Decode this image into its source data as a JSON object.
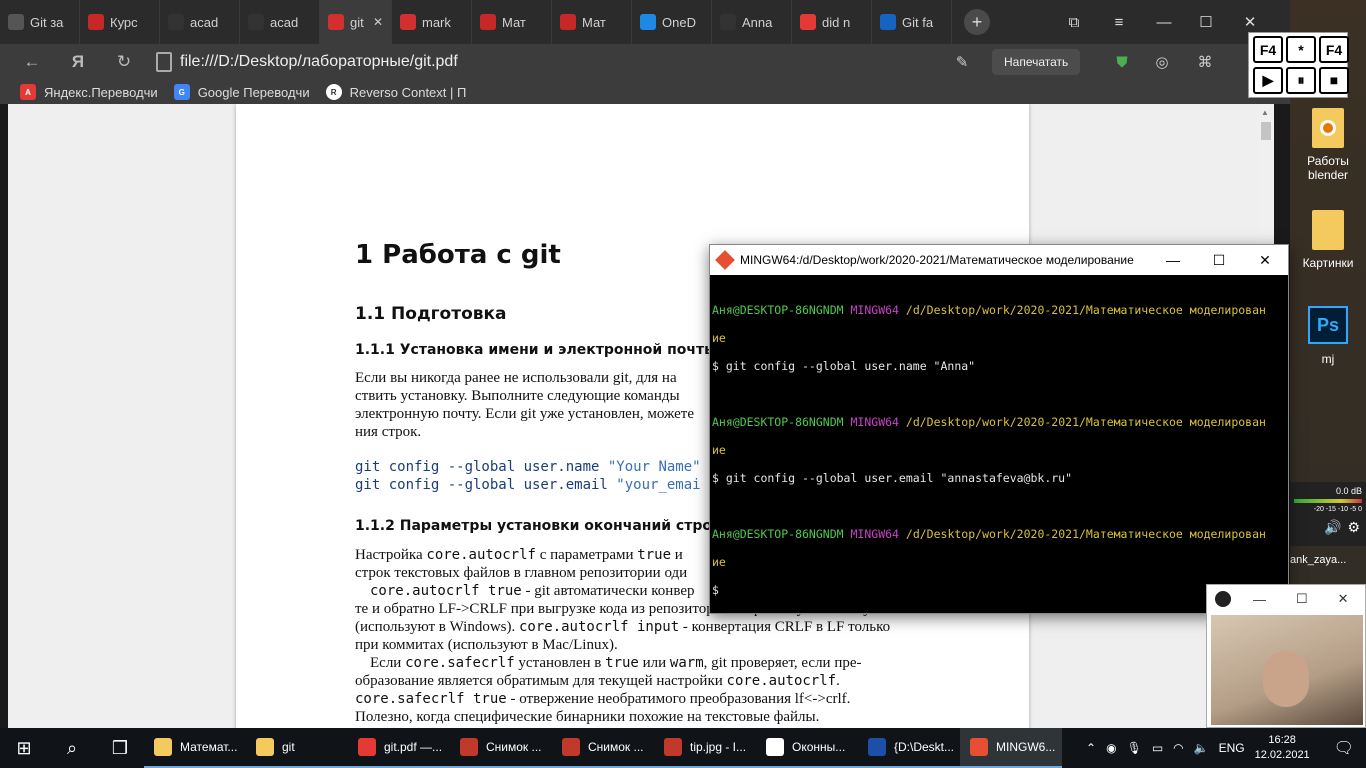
{
  "browser": {
    "tabs": [
      {
        "label": "Git за",
        "icon": "sparkle-icon",
        "color": "#555555"
      },
      {
        "label": "Курс",
        "icon": "course-icon",
        "color": "#c62828"
      },
      {
        "label": "acad",
        "icon": "github-icon",
        "color": "#333333"
      },
      {
        "label": "acad",
        "icon": "github-icon",
        "color": "#333333"
      },
      {
        "label": "git",
        "icon": "pdf-icon",
        "color": "#d32f2f",
        "active": true
      },
      {
        "label": "mark",
        "icon": "pdf-icon",
        "color": "#d32f2f"
      },
      {
        "label": "Мат",
        "icon": "course-icon",
        "color": "#c62828"
      },
      {
        "label": "Мат",
        "icon": "course-icon",
        "color": "#c62828"
      },
      {
        "label": "OneD",
        "icon": "onedrive-icon",
        "color": "#1e88e5"
      },
      {
        "label": "Anna",
        "icon": "github-icon",
        "color": "#333333"
      },
      {
        "label": "did n",
        "icon": "yandex-icon",
        "color": "#e53935"
      },
      {
        "label": "Git fa",
        "icon": "stackoverflow-icon",
        "color": "#1565c0"
      }
    ],
    "tab_close": "✕",
    "new_tab": "+",
    "url": "file:///D:/Desktop/лабораторные/git.pdf",
    "back_icon": "←",
    "yandex_icon": "Я",
    "reload_icon": "↻",
    "print_label": "Напечатать",
    "bookmarks": [
      {
        "label": "Яндекс.Переводчи",
        "icon": "yandex-translate-icon"
      },
      {
        "label": "Google Переводчи",
        "icon": "google-translate-icon"
      },
      {
        "label": "Reverso Context | П",
        "icon": "reverso-icon"
      }
    ]
  },
  "pdf": {
    "h1": "1  Работа с git",
    "h2": "1.1  Подготовка",
    "h3a": "1.1.1  Установка имени и электронной почты",
    "p1": [
      "Если вы никогда ранее не использовали git, для на",
      "ствить установку. Выполните следующие команды",
      "электронную почту. Если git уже установлен, можете",
      "ния строк."
    ],
    "code1": {
      "cmd": "git config --global user.name ",
      "arg": "\"Your Name\""
    },
    "code2": {
      "cmd": "git config --global user.email ",
      "arg": "\"your_emai"
    },
    "h3b": "1.1.2  Параметры установки окончаний строк",
    "p2_1": {
      "a": "Настройка ",
      "b": "core.autocrlf",
      "c": " с параметрами ",
      "d": "true",
      "e": " и"
    },
    "p2_2": "строк текстовых файлов в главном репозитории оди",
    "p3_1": {
      "a": "core.autocrlf true",
      "b": " - git автоматически конвер"
    },
    "p3_2": "те и обратно LF->CRLF при выгрузке кода из репозитория на файловую систему",
    "p3_3": {
      "a": "(используют в Windows). ",
      "b": "core.autocrlf input",
      "c": " - конвертация CRLF в LF только"
    },
    "p3_4": "при коммитах (используют в Mac/Linux).",
    "p4_1": {
      "a": "Если ",
      "b": "core.safecrlf",
      "c": " установлен в ",
      "d": "true",
      "e": " или ",
      "f": "warm",
      "g": ", git проверяет, если пре-"
    },
    "p4_2": {
      "a": "образование является обратимым для текущей настройки ",
      "b": "core.autocrlf",
      "c": "."
    },
    "p4_3": {
      "a": "core.safecrlf true",
      "b": " - отвержение необратимого преобразования lf<->crlf."
    },
    "p4_4": "Полезно, когда специфические бинарники похожие на текстовые файлы."
  },
  "terminal": {
    "title": "MINGW64:/d/Desktop/work/2020-2021/Математическое моделирование",
    "min": "—",
    "max": "☐",
    "close": "✕",
    "user": "Аня@DESKTOP-86NGNDM",
    "env": "MINGW64",
    "path": "/d/Desktop/work/2020-2021/Математическое моделирован",
    "path_wrap": "ие",
    "cmd1": "$ git config --global user.name \"Anna\"",
    "cmd2": "$ git config --global user.email \"annastafeva@bk.ru\"",
    "prompt": "$"
  },
  "desktop": {
    "icons": [
      {
        "label": "Работы blender",
        "kind": "blender-folder-icon"
      },
      {
        "label": "Картинки",
        "kind": "folder-icon"
      },
      {
        "label": "mj",
        "kind": "photoshop-icon"
      }
    ],
    "f4_buttons": [
      "F4",
      "*",
      "F4",
      "▶",
      "⏸",
      "■"
    ],
    "volume_db": "0.0 dB",
    "volume_scale": "-20 -15 -10 -5 0",
    "obs_label": "ank_zaya..."
  },
  "taskbar": {
    "apps": [
      {
        "label": "Математ...",
        "icon": "folder-icon",
        "color": "#f4c95d"
      },
      {
        "label": "git",
        "icon": "folder-icon",
        "color": "#f4c95d"
      },
      {
        "label": "git.pdf —...",
        "icon": "yandex-browser-icon",
        "color": "#e53935"
      },
      {
        "label": "Снимок ...",
        "icon": "snip-icon",
        "color": "#c0392b"
      },
      {
        "label": "Снимок ...",
        "icon": "snip-icon",
        "color": "#c0392b"
      },
      {
        "label": "tip.jpg - I...",
        "icon": "paint-icon",
        "color": "#c0392b"
      },
      {
        "label": "Оконны...",
        "icon": "obs-icon",
        "color": "#ffffff"
      },
      {
        "label": "{D:\\Deskt...",
        "icon": "far-icon",
        "color": "#1e4fa8"
      },
      {
        "label": "MINGW6...",
        "icon": "git-bash-icon",
        "color": "#e84e31",
        "active": true
      }
    ],
    "lang": "ENG",
    "time": "16:28",
    "date": "12.02.2021"
  }
}
